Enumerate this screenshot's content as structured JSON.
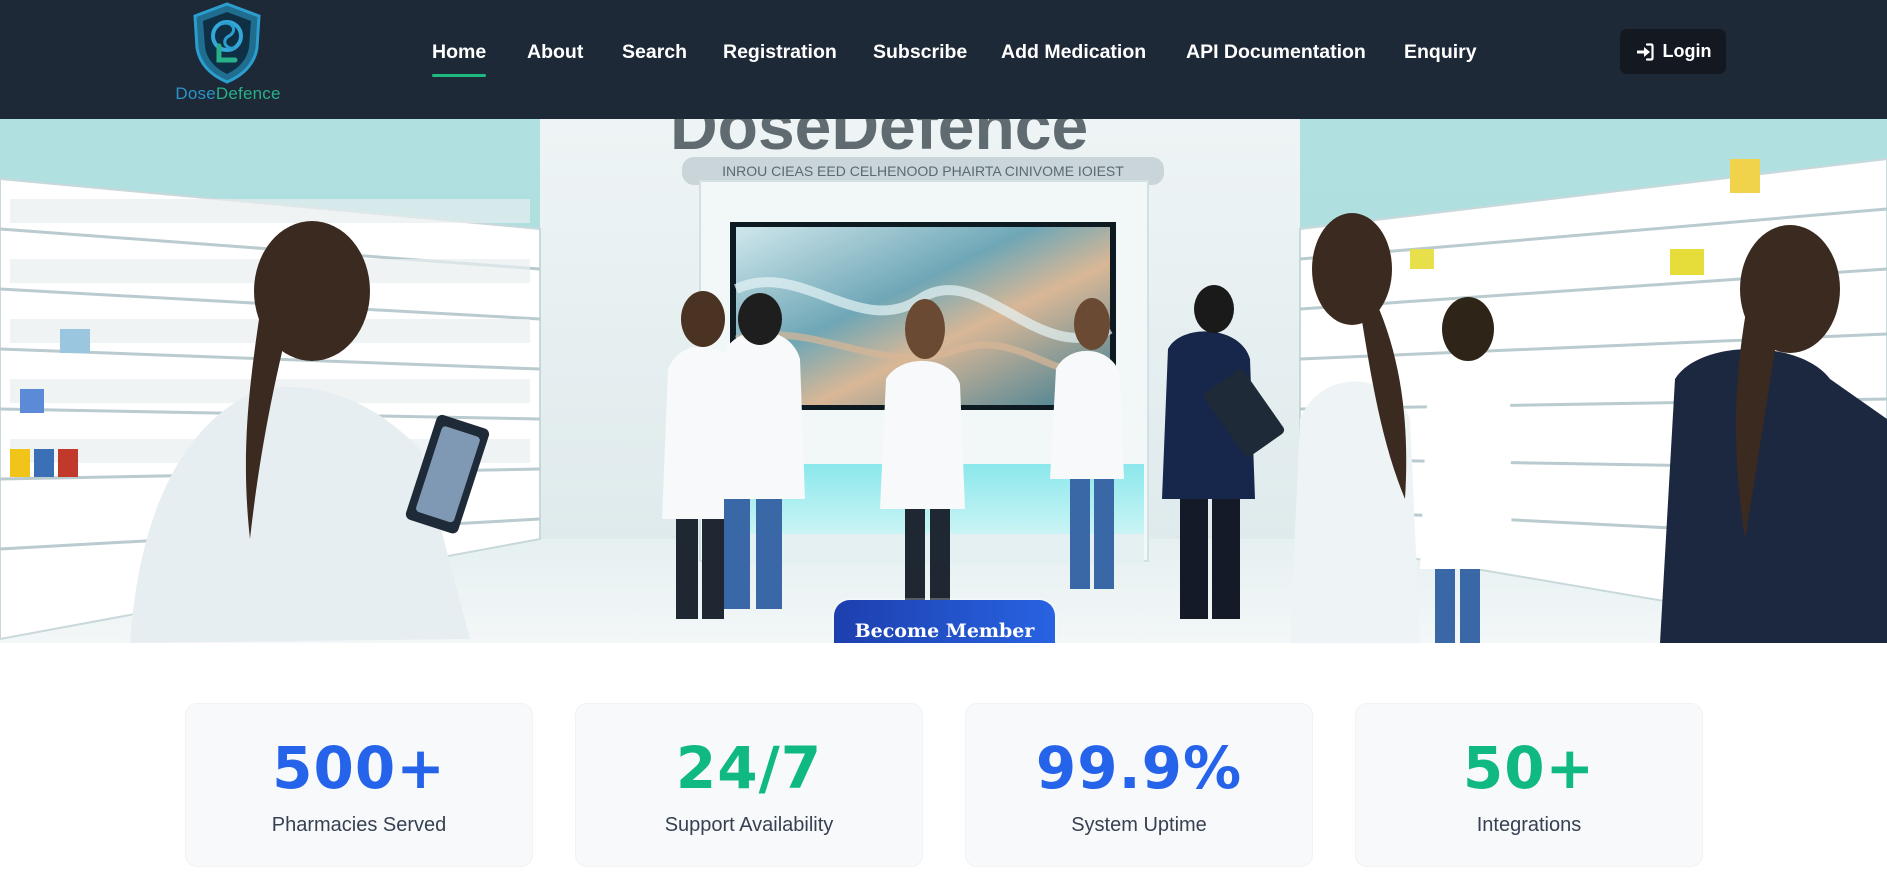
{
  "brand": {
    "name_part1": "Dose",
    "name_part2": "Defence",
    "color1": "#2a93c9",
    "color2": "#27b08a"
  },
  "nav": {
    "items": [
      {
        "label": "Home",
        "active": true
      },
      {
        "label": "About"
      },
      {
        "label": "Search"
      },
      {
        "label": "Registration"
      },
      {
        "label": "Subscribe"
      },
      {
        "label": "Add Medication"
      },
      {
        "label": "API Documentation"
      },
      {
        "label": "Enquiry"
      }
    ],
    "login_label": "Login",
    "login_icon": "sign-in-icon"
  },
  "hero": {
    "sign_text": "DoseDefence",
    "subtitle_text": "INROU CIEAS EED CELHENOOD PHAIRTA CINIVOME IOIEST",
    "cta_label": "Become Member"
  },
  "stats": [
    {
      "value": "500+",
      "label": "Pharmacies Served",
      "color": "#2563eb"
    },
    {
      "value": "24/7",
      "label": "Support Availability",
      "color": "#10b981"
    },
    {
      "value": "99.9%",
      "label": "System Uptime",
      "color": "#2563eb"
    },
    {
      "value": "50+",
      "label": "Integrations",
      "color": "#10b981"
    }
  ],
  "colors": {
    "header_bg": "#1e2937",
    "nav_active_underline": "#1eb980",
    "cta_bg": "#2563eb"
  }
}
